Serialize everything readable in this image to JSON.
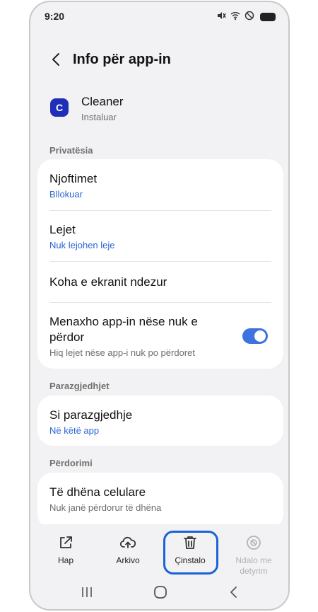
{
  "status_bar": {
    "time": "9:20",
    "icons": [
      "mute-icon",
      "wifi-icon",
      "do-not-disturb-icon",
      "battery-icon"
    ]
  },
  "header": {
    "title": "Info për app-in",
    "back_icon": "back-arrow-icon"
  },
  "app": {
    "icon_letter": "C",
    "name": "Cleaner",
    "status": "Instaluar"
  },
  "sections": {
    "privacy": {
      "label": "Privatësia",
      "notifications_label": "Njoftimet",
      "notifications_value": "Bllokuar",
      "permissions_label": "Lejet",
      "permissions_value": "Nuk lejohen leje",
      "screen_time_label": "Koha e ekranit ndezur",
      "manage_label_line1": "Menaxho app-in nëse nuk e",
      "manage_label_line2": "përdor",
      "manage_sub": "Hiq lejet nëse app-i nuk po përdoret",
      "manage_toggle_on": true
    },
    "defaults": {
      "label": "Parazgjedhjet",
      "item_label": "Si parazgjedhje",
      "item_value": "Në këtë app"
    },
    "usage": {
      "label": "Përdorimi",
      "item_label": "Të dhëna celulare",
      "item_value": "Nuk janë përdorur të dhëna"
    }
  },
  "actions": {
    "open": "Hap",
    "archive": "Arkivo",
    "uninstall": "Çinstalo",
    "force_stop_line1": "Ndalo me",
    "force_stop_line2": "detyrim"
  },
  "colors": {
    "accent": "#3d72df",
    "link": "#2a64d6",
    "highlight": "#1a63d6",
    "app_icon": "#1f2fb8"
  }
}
